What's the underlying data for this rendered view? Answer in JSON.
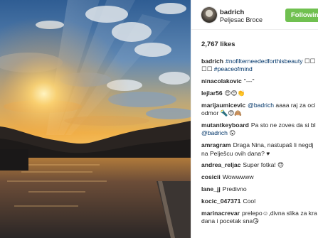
{
  "post": {
    "username": "badrich",
    "location": "Peljesac Broce",
    "follow_label": "Following",
    "likes": "2,767 likes"
  },
  "comments": [
    {
      "user": "badrich",
      "lines": [
        [
          {
            "t": "#nofilterneededforthisbeauty",
            "link": true
          },
          {
            "t": " ☐☐"
          }
        ],
        [
          {
            "t": "☐☐ "
          },
          {
            "t": "#peaceofmind",
            "link": true
          }
        ]
      ]
    },
    {
      "user": "ninacolakovic",
      "lines": [
        [
          {
            "t": "\"---\""
          }
        ]
      ]
    },
    {
      "user": "lejlar56",
      "lines": [
        [
          {
            "t": "😍😍👏"
          }
        ]
      ]
    },
    {
      "user": "marijaumicevic",
      "lines": [
        [
          {
            "t": "@badrich",
            "link": true
          },
          {
            "t": " aaaa raj za oci"
          }
        ],
        [
          {
            "t": "odmor 🔦😍🙈"
          }
        ]
      ]
    },
    {
      "user": "mutantkeyboard",
      "lines": [
        [
          {
            "t": "Pa sto ne zoves da si bl"
          }
        ],
        [
          {
            "t": "@badrich",
            "link": true
          },
          {
            "t": " 😮"
          }
        ]
      ]
    },
    {
      "user": "amragram",
      "lines": [
        [
          {
            "t": "Draga Nina, nastupaš li negdj"
          }
        ],
        [
          {
            "t": "na Pelješcu ovih dana? ♥"
          }
        ]
      ]
    },
    {
      "user": "andrea_reljac",
      "lines": [
        [
          {
            "t": "Super fotka! 😍"
          }
        ]
      ]
    },
    {
      "user": "cosicii",
      "lines": [
        [
          {
            "t": "Wowwwww"
          }
        ]
      ]
    },
    {
      "user": "lane_jj",
      "lines": [
        [
          {
            "t": "Predivno"
          }
        ]
      ]
    },
    {
      "user": "kocic_047371",
      "lines": [
        [
          {
            "t": "Cool"
          }
        ]
      ]
    },
    {
      "user": "marinacrevar",
      "lines": [
        [
          {
            "t": "prelepo☺,divna slika za kra"
          }
        ],
        [
          {
            "t": "dana i pocetak sna😘"
          }
        ]
      ]
    }
  ],
  "icons": {
    "avatar": "profile-photo"
  },
  "colors": {
    "follow_button": "#70c050",
    "link": "#003569"
  }
}
